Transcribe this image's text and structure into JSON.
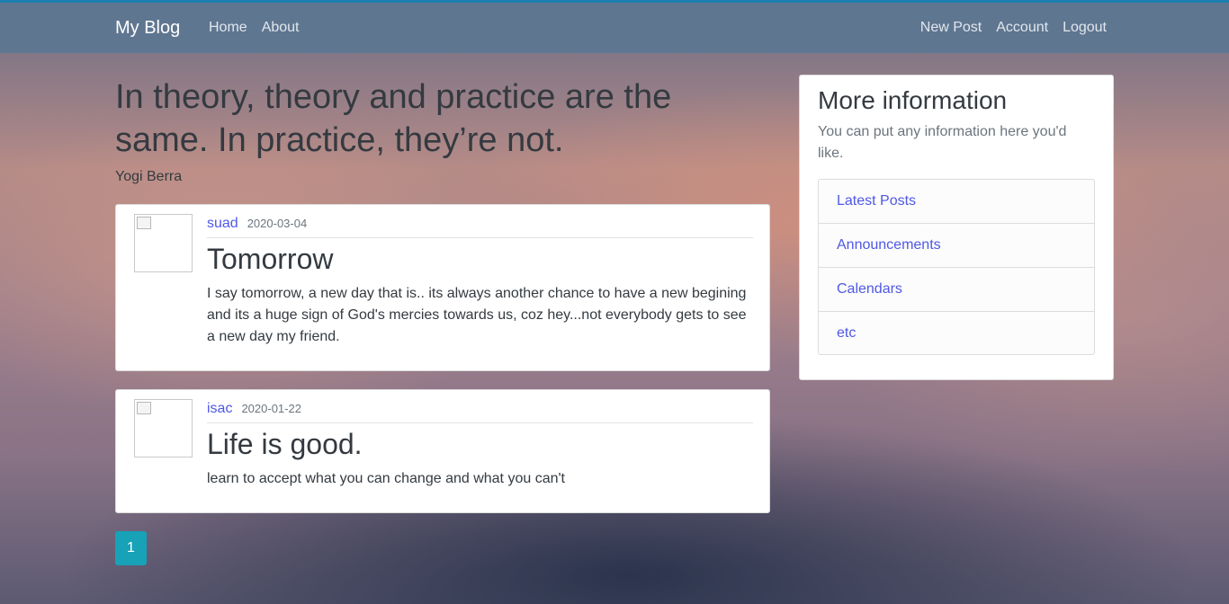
{
  "navbar": {
    "brand": "My Blog",
    "left_links": [
      "Home",
      "About"
    ],
    "right_links": [
      "New Post",
      "Account",
      "Logout"
    ]
  },
  "quote": {
    "text": "In theory, theory and practice are the same. In practice, they’re not.",
    "author": "Yogi Berra"
  },
  "posts": [
    {
      "author": "suad",
      "date": "2020-03-04",
      "title": "Tomorrow",
      "content": "I say tomorrow, a new day that is.. its always another chance to have a new begining and its a huge sign of God's mercies towards us, coz hey...not everybody gets to see a new day my friend."
    },
    {
      "author": "isac",
      "date": "2020-01-22",
      "title": "Life is good.",
      "content": "learn to accept what you can change and what you can't"
    }
  ],
  "pagination": {
    "current": "1"
  },
  "sidebar": {
    "title": "More information",
    "text": "You can put any information here you'd like.",
    "items": [
      "Latest Posts",
      "Announcements",
      "Calendars",
      "etc"
    ]
  },
  "colors": {
    "navbar": "#5f7690",
    "link": "#4f58e6",
    "pagination_active": "#17a2b8"
  }
}
